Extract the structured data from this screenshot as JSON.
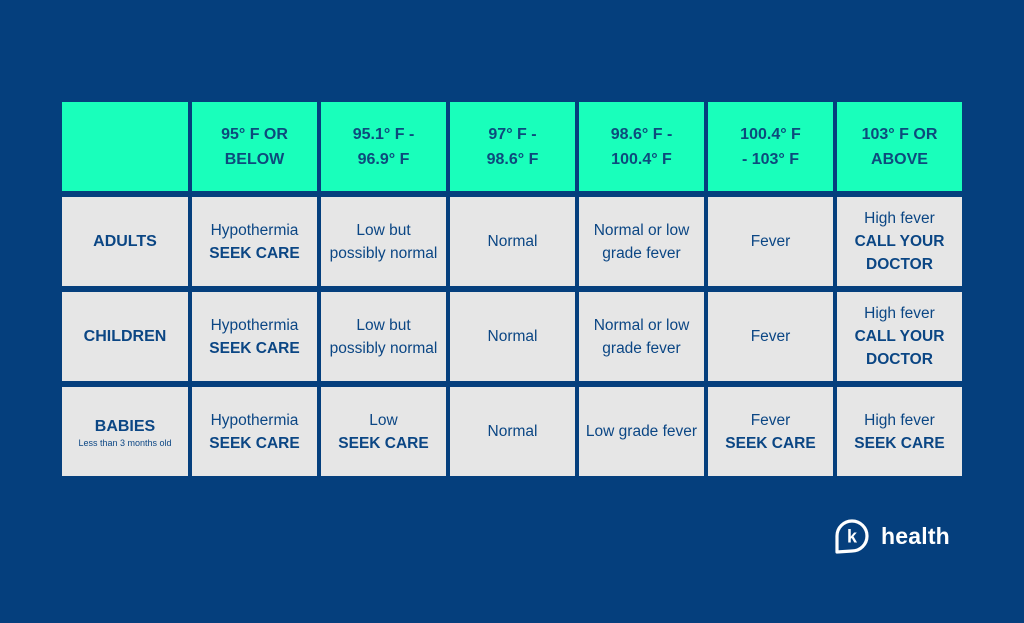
{
  "colors": {
    "background": "#053f7d",
    "header_fill": "#19ffbb",
    "cell_fill": "#e6e6e6",
    "text": "#0b4684"
  },
  "table": {
    "columns": [
      "",
      [
        "95° F OR",
        "BELOW"
      ],
      [
        "95.1° F -",
        "96.9° F"
      ],
      [
        "97° F -",
        "98.6° F"
      ],
      [
        "98.6° F -",
        "100.4° F"
      ],
      [
        "100.4° F",
        "- 103° F"
      ],
      [
        "103° F OR",
        "ABOVE"
      ]
    ],
    "rows": [
      {
        "label": "ADULTS",
        "sublabel": "",
        "cells": [
          {
            "text": "Hypothermia",
            "action": "SEEK CARE"
          },
          {
            "text": "Low but possibly normal",
            "action": ""
          },
          {
            "text": "Normal",
            "action": ""
          },
          {
            "text": "Normal or low grade fever",
            "action": ""
          },
          {
            "text": "Fever",
            "action": ""
          },
          {
            "text": "High fever",
            "action": "CALL YOUR DOCTOR"
          }
        ]
      },
      {
        "label": "CHILDREN",
        "sublabel": "",
        "cells": [
          {
            "text": "Hypothermia",
            "action": "SEEK CARE"
          },
          {
            "text": "Low but possibly normal",
            "action": ""
          },
          {
            "text": "Normal",
            "action": ""
          },
          {
            "text": "Normal or low grade fever",
            "action": ""
          },
          {
            "text": "Fever",
            "action": ""
          },
          {
            "text": "High fever",
            "action": "CALL YOUR DOCTOR"
          }
        ]
      },
      {
        "label": "BABIES",
        "sublabel": "Less than 3 months old",
        "cells": [
          {
            "text": "Hypothermia",
            "action": "SEEK CARE"
          },
          {
            "text": "Low",
            "action": "SEEK CARE"
          },
          {
            "text": "Normal",
            "action": ""
          },
          {
            "text": "Low grade fever",
            "action": ""
          },
          {
            "text": "Fever",
            "action": "SEEK CARE"
          },
          {
            "text": "High fever",
            "action": "SEEK CARE"
          }
        ]
      }
    ]
  },
  "logo": {
    "icon": "k-speech-bubble-icon",
    "letter": "k",
    "text": "health"
  }
}
